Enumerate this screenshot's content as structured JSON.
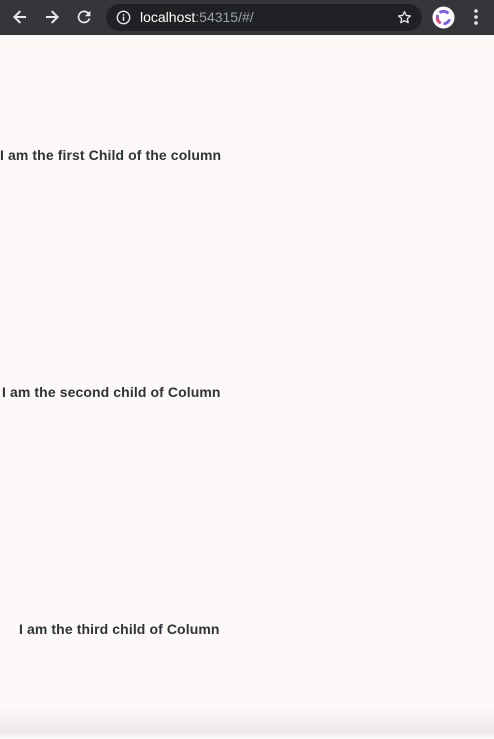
{
  "browser": {
    "url_host": "localhost",
    "url_rest": ":54315/#/",
    "icons": {
      "back": "back-arrow-icon",
      "forward": "forward-arrow-icon",
      "reload": "reload-icon",
      "info": "info-icon",
      "bookmark": "star-icon",
      "profile": "profile-icon",
      "menu": "more-vert-icon"
    }
  },
  "column": {
    "children": [
      {
        "text": "I am the first Child of the column"
      },
      {
        "text": "I am the second child of Column"
      },
      {
        "text": "I am the third child of Column"
      }
    ]
  },
  "colors": {
    "browser_bar": "#35363a",
    "omnibox": "#202124",
    "page_background": "#fdf9f8",
    "text": "#2e3338"
  }
}
